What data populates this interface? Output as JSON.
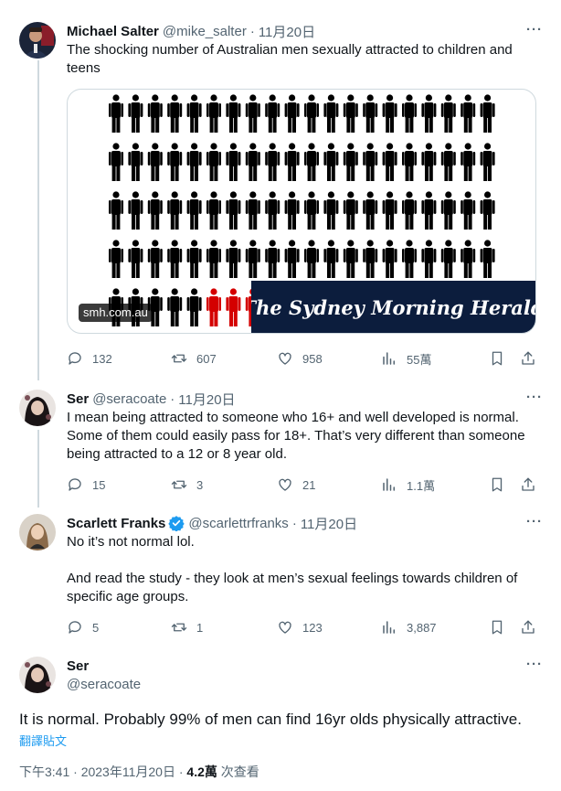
{
  "tweets": [
    {
      "name": "Michael Salter",
      "handle": "@mike_salter",
      "separator": "·",
      "date": "11月20日",
      "text": [
        "The shocking number of Australian men sexually attracted to children and teens"
      ],
      "media": {
        "source": "smh.com.au",
        "masthead": "The Sydney Morning Herald",
        "figure_rows": 5,
        "figures_per_row": 20,
        "highlighted_figures_last_row": 3,
        "figure_color": "#000000",
        "highlight_color": "#d40000"
      },
      "stats": {
        "replies": "132",
        "reposts": "607",
        "likes": "958",
        "views": "55萬"
      },
      "more": "···"
    },
    {
      "name": "Ser",
      "handle": "@seracoate",
      "separator": "·",
      "date": "11月20日",
      "text": [
        "I mean being attracted to someone who 16+ and well developed is normal. Some of them could easily pass for 18+. That’s very different than someone being attracted to a 12 or 8 year old."
      ],
      "stats": {
        "replies": "15",
        "reposts": "3",
        "likes": "21",
        "views": "1.1萬"
      },
      "more": "···"
    },
    {
      "name": "Scarlett Franks",
      "handle": "@scarlettrfranks",
      "separator": "·",
      "date": "11月20日",
      "verified": true,
      "text": [
        "No it’s not normal lol.",
        "And read the study - they look at men’s sexual feelings towards children of specific age groups."
      ],
      "stats": {
        "replies": "5",
        "reposts": "1",
        "likes": "123",
        "views": "3,887"
      },
      "more": "···"
    }
  ],
  "focal": {
    "name": "Ser",
    "handle": "@seracoate",
    "more": "···",
    "text": "It is normal. Probably 99% of men can find 16yr olds physically attractive.",
    "translate": "翻譯貼文",
    "time": "下午3:41",
    "separator": "·",
    "date": "2023年11月20日",
    "separator2": "·",
    "views_count": "4.2萬",
    "views_label": "次查看"
  },
  "colors": {
    "accent": "#1d9bf0",
    "muted": "#536471",
    "text": "#0f1419",
    "border": "#cfd9de"
  }
}
